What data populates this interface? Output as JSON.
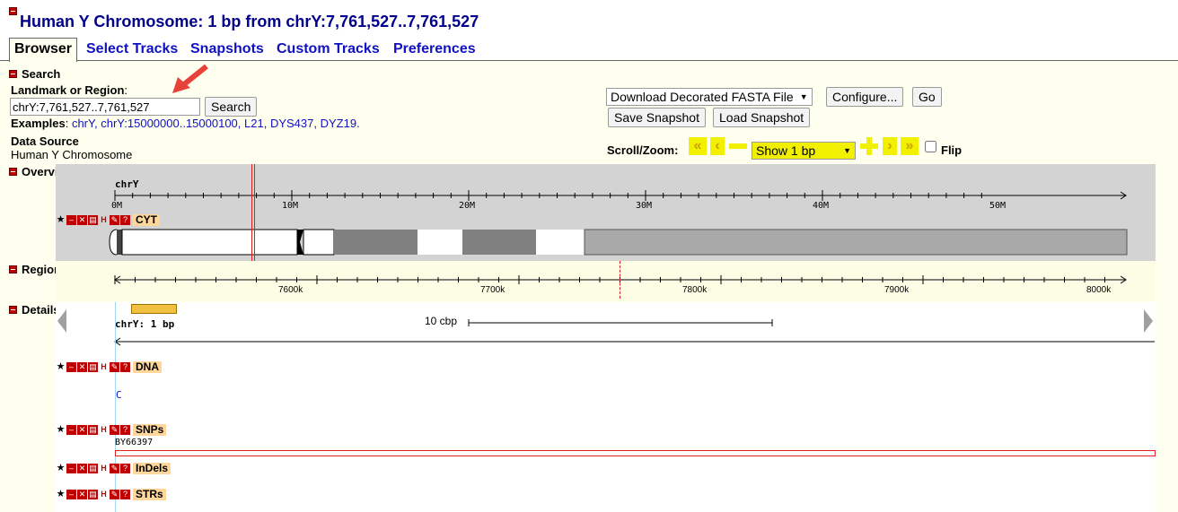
{
  "header": {
    "title": "Human Y Chromosome: 1 bp from chrY:7,761,527..7,761,527"
  },
  "tabs": [
    {
      "label": "Browser"
    },
    {
      "label": "Select Tracks"
    },
    {
      "label": "Snapshots"
    },
    {
      "label": "Custom Tracks"
    },
    {
      "label": "Preferences"
    }
  ],
  "search": {
    "section_title": "Search",
    "landmark_label": "Landmark or Region",
    "landmark_colon": ":",
    "input_value": "chrY:7,761,527..7,761,527",
    "search_button": "Search",
    "examples_label": "Examples",
    "examples_colon": ":",
    "examples": [
      "chrY,",
      "chrY:15000000..15000100,",
      "L21,",
      "DYS437,",
      "DYZ19."
    ],
    "data_source_label": "Data Source",
    "data_source_value": "Human Y Chromosome"
  },
  "actions": {
    "download_select": "Download Decorated FASTA File",
    "configure_button": "Configure...",
    "go_button": "Go",
    "save_snapshot": "Save Snapshot",
    "load_snapshot": "Load Snapshot",
    "scroll_zoom_label": "Scroll/Zoom:",
    "zoom_select": "Show 1 bp",
    "flip_label": "Flip"
  },
  "overview": {
    "section_title": "Overview",
    "chrom_label": "chrY",
    "ticks": [
      "0M",
      "10M",
      "20M",
      "30M",
      "40M",
      "50M"
    ],
    "track_name": "CYT"
  },
  "region": {
    "section_title": "Region",
    "ticks": [
      "7600k",
      "7700k",
      "7800k",
      "7900k",
      "8000k"
    ]
  },
  "details": {
    "section_title": "Details",
    "scale_label": "10 cbp",
    "position_label": "chrY: 1 bp",
    "tracks": [
      {
        "name": "DNA",
        "content": "C"
      },
      {
        "name": "SNPs",
        "content": "BY66397"
      },
      {
        "name": "InDels",
        "content": ""
      },
      {
        "name": "STRs",
        "content": ""
      }
    ]
  },
  "colors": {
    "link": "#1010c0",
    "title": "#00008b",
    "track_label_bg": "#ffd79a",
    "highlight_red": "#e02020",
    "zoom_yellow": "#f0f000"
  }
}
